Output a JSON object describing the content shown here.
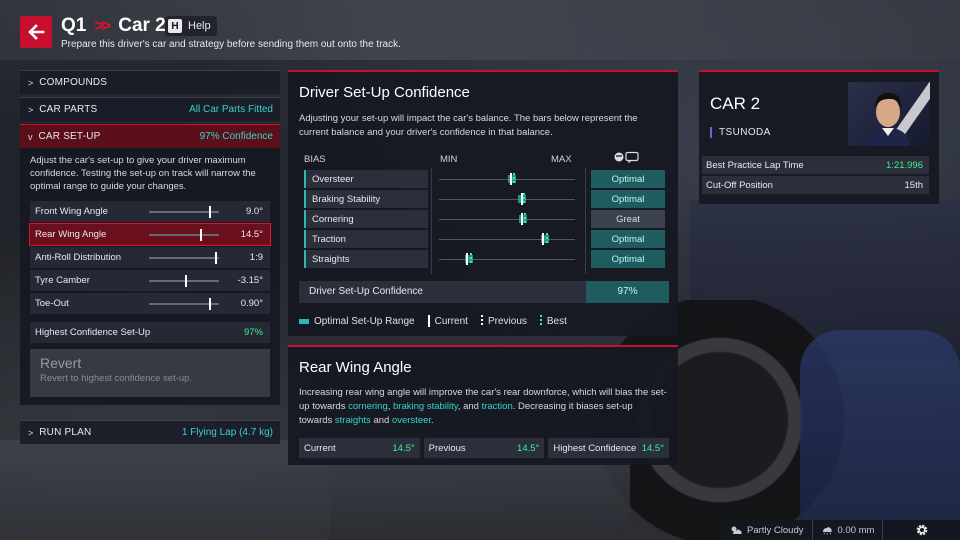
{
  "header": {
    "session": "Q1",
    "car": "Car 2",
    "help_key": "H",
    "help_label": "Help",
    "subtitle": "Prepare this driver's car and strategy before sending them out onto the track."
  },
  "left_panel": {
    "compounds": {
      "label": "COMPOUNDS"
    },
    "car_parts": {
      "label": "CAR PARTS",
      "value": "All Car Parts Fitted"
    },
    "car_setup": {
      "label": "CAR SET-UP",
      "value": "97% Confidence",
      "description": "Adjust the car's set-up to give your driver maximum confidence. Testing the set-up on track will narrow the optimal range to guide your changes.",
      "params": [
        {
          "name": "Front Wing Angle",
          "value": "9.0°",
          "position": 0.88
        },
        {
          "name": "Rear Wing Angle",
          "value": "14.5°",
          "position": 0.75
        },
        {
          "name": "Anti-Roll Distribution",
          "value": "1:9",
          "position": 0.97
        },
        {
          "name": "Tyre Camber",
          "value": "-3.15°",
          "position": 0.53
        },
        {
          "name": "Toe-Out",
          "value": "0.90°",
          "position": 0.88
        }
      ],
      "highest_label": "Highest Confidence Set-Up",
      "highest_value": "97%",
      "revert_title": "Revert",
      "revert_sub": "Revert to highest confidence set-up."
    },
    "run_plan": {
      "label": "RUN PLAN",
      "value": "1 Flying Lap (4.7 kg)"
    }
  },
  "confidence": {
    "title": "Driver Set-Up Confidence",
    "description": "Adjusting your set-up will impact the car's balance. The bars below represent the current balance and your driver's confidence in that balance.",
    "col_bias": "BIAS",
    "col_min": "MIN",
    "col_max": "MAX",
    "rows": [
      {
        "name": "Oversteer",
        "rating": "Optimal",
        "current": 0.52,
        "best": 0.53
      },
      {
        "name": "Braking Stability",
        "rating": "Optimal",
        "current": 0.6,
        "best": 0.6
      },
      {
        "name": "Cornering",
        "rating": "Great",
        "current": 0.6,
        "best": 0.61
      },
      {
        "name": "Traction",
        "rating": "Optimal",
        "current": 0.76,
        "best": 0.77
      },
      {
        "name": "Straights",
        "rating": "Optimal",
        "current": 0.2,
        "best": 0.21
      }
    ],
    "total_label": "Driver Set-Up Confidence",
    "total_value": "97%",
    "legend": {
      "optimal": "Optimal Set-Up Range",
      "current": "Current",
      "previous": "Previous",
      "best": "Best"
    },
    "colors": {
      "optimal": "#2fb8b0",
      "current": "#ffffff",
      "best": "#3ef08a"
    }
  },
  "rear_wing": {
    "title": "Rear Wing Angle",
    "desc_1": "Increasing rear wing angle will improve the car's rear downforce, which will bias the set-up towards ",
    "kw_cornering": "cornering",
    "sep_1": ", ",
    "kw_braking": "braking stability",
    "sep_2": ", and ",
    "kw_traction": "traction",
    "desc_2": ". Decreasing it biases set-up towards ",
    "kw_straights": "straights",
    "sep_3": " and ",
    "kw_oversteer": "oversteer",
    "desc_end": ".",
    "stats": [
      {
        "label": "Current",
        "value": "14.5°"
      },
      {
        "label": "Previous",
        "value": "14.5°"
      },
      {
        "label": "Highest Confidence",
        "value": "14.5°"
      }
    ]
  },
  "driver": {
    "car": "CAR 2",
    "name": "TSUNODA",
    "best_lap_label": "Best Practice Lap Time",
    "best_lap_value": "1:21.996",
    "cutoff_label": "Cut-Off Position",
    "cutoff_value": "15th"
  },
  "status": {
    "weather": "Partly Cloudy",
    "rain": "0.00 mm"
  }
}
